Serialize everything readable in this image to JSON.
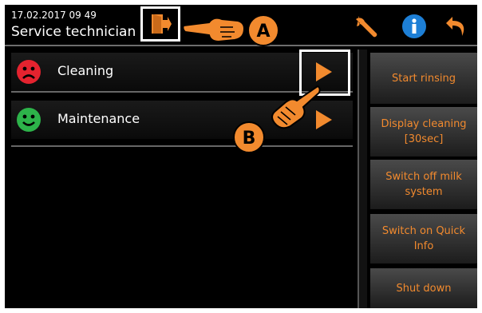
{
  "header": {
    "datetime": "17.02.2017 09 49",
    "role": "Service technician"
  },
  "icons": {
    "logout": "logout-door-icon",
    "wrench": "wrench-icon",
    "info": "info-icon",
    "back": "back-arrow-icon"
  },
  "menu": {
    "items": [
      {
        "label": "Cleaning",
        "status": "sad-red"
      },
      {
        "label": "Maintenance",
        "status": "happy-green"
      }
    ]
  },
  "sidebar": {
    "buttons": [
      {
        "label": "Start rinsing"
      },
      {
        "label": "Display cleaning [30sec]"
      },
      {
        "label": "Switch off milk system"
      },
      {
        "label": "Switch on Quick Info"
      },
      {
        "label": "Shut down"
      }
    ]
  },
  "callouts": {
    "a": "A",
    "b": "B"
  },
  "colors": {
    "accent": "#f28a2e",
    "status_red": "#e4232f",
    "status_green": "#2db34a",
    "info_blue": "#1d7fd6"
  }
}
